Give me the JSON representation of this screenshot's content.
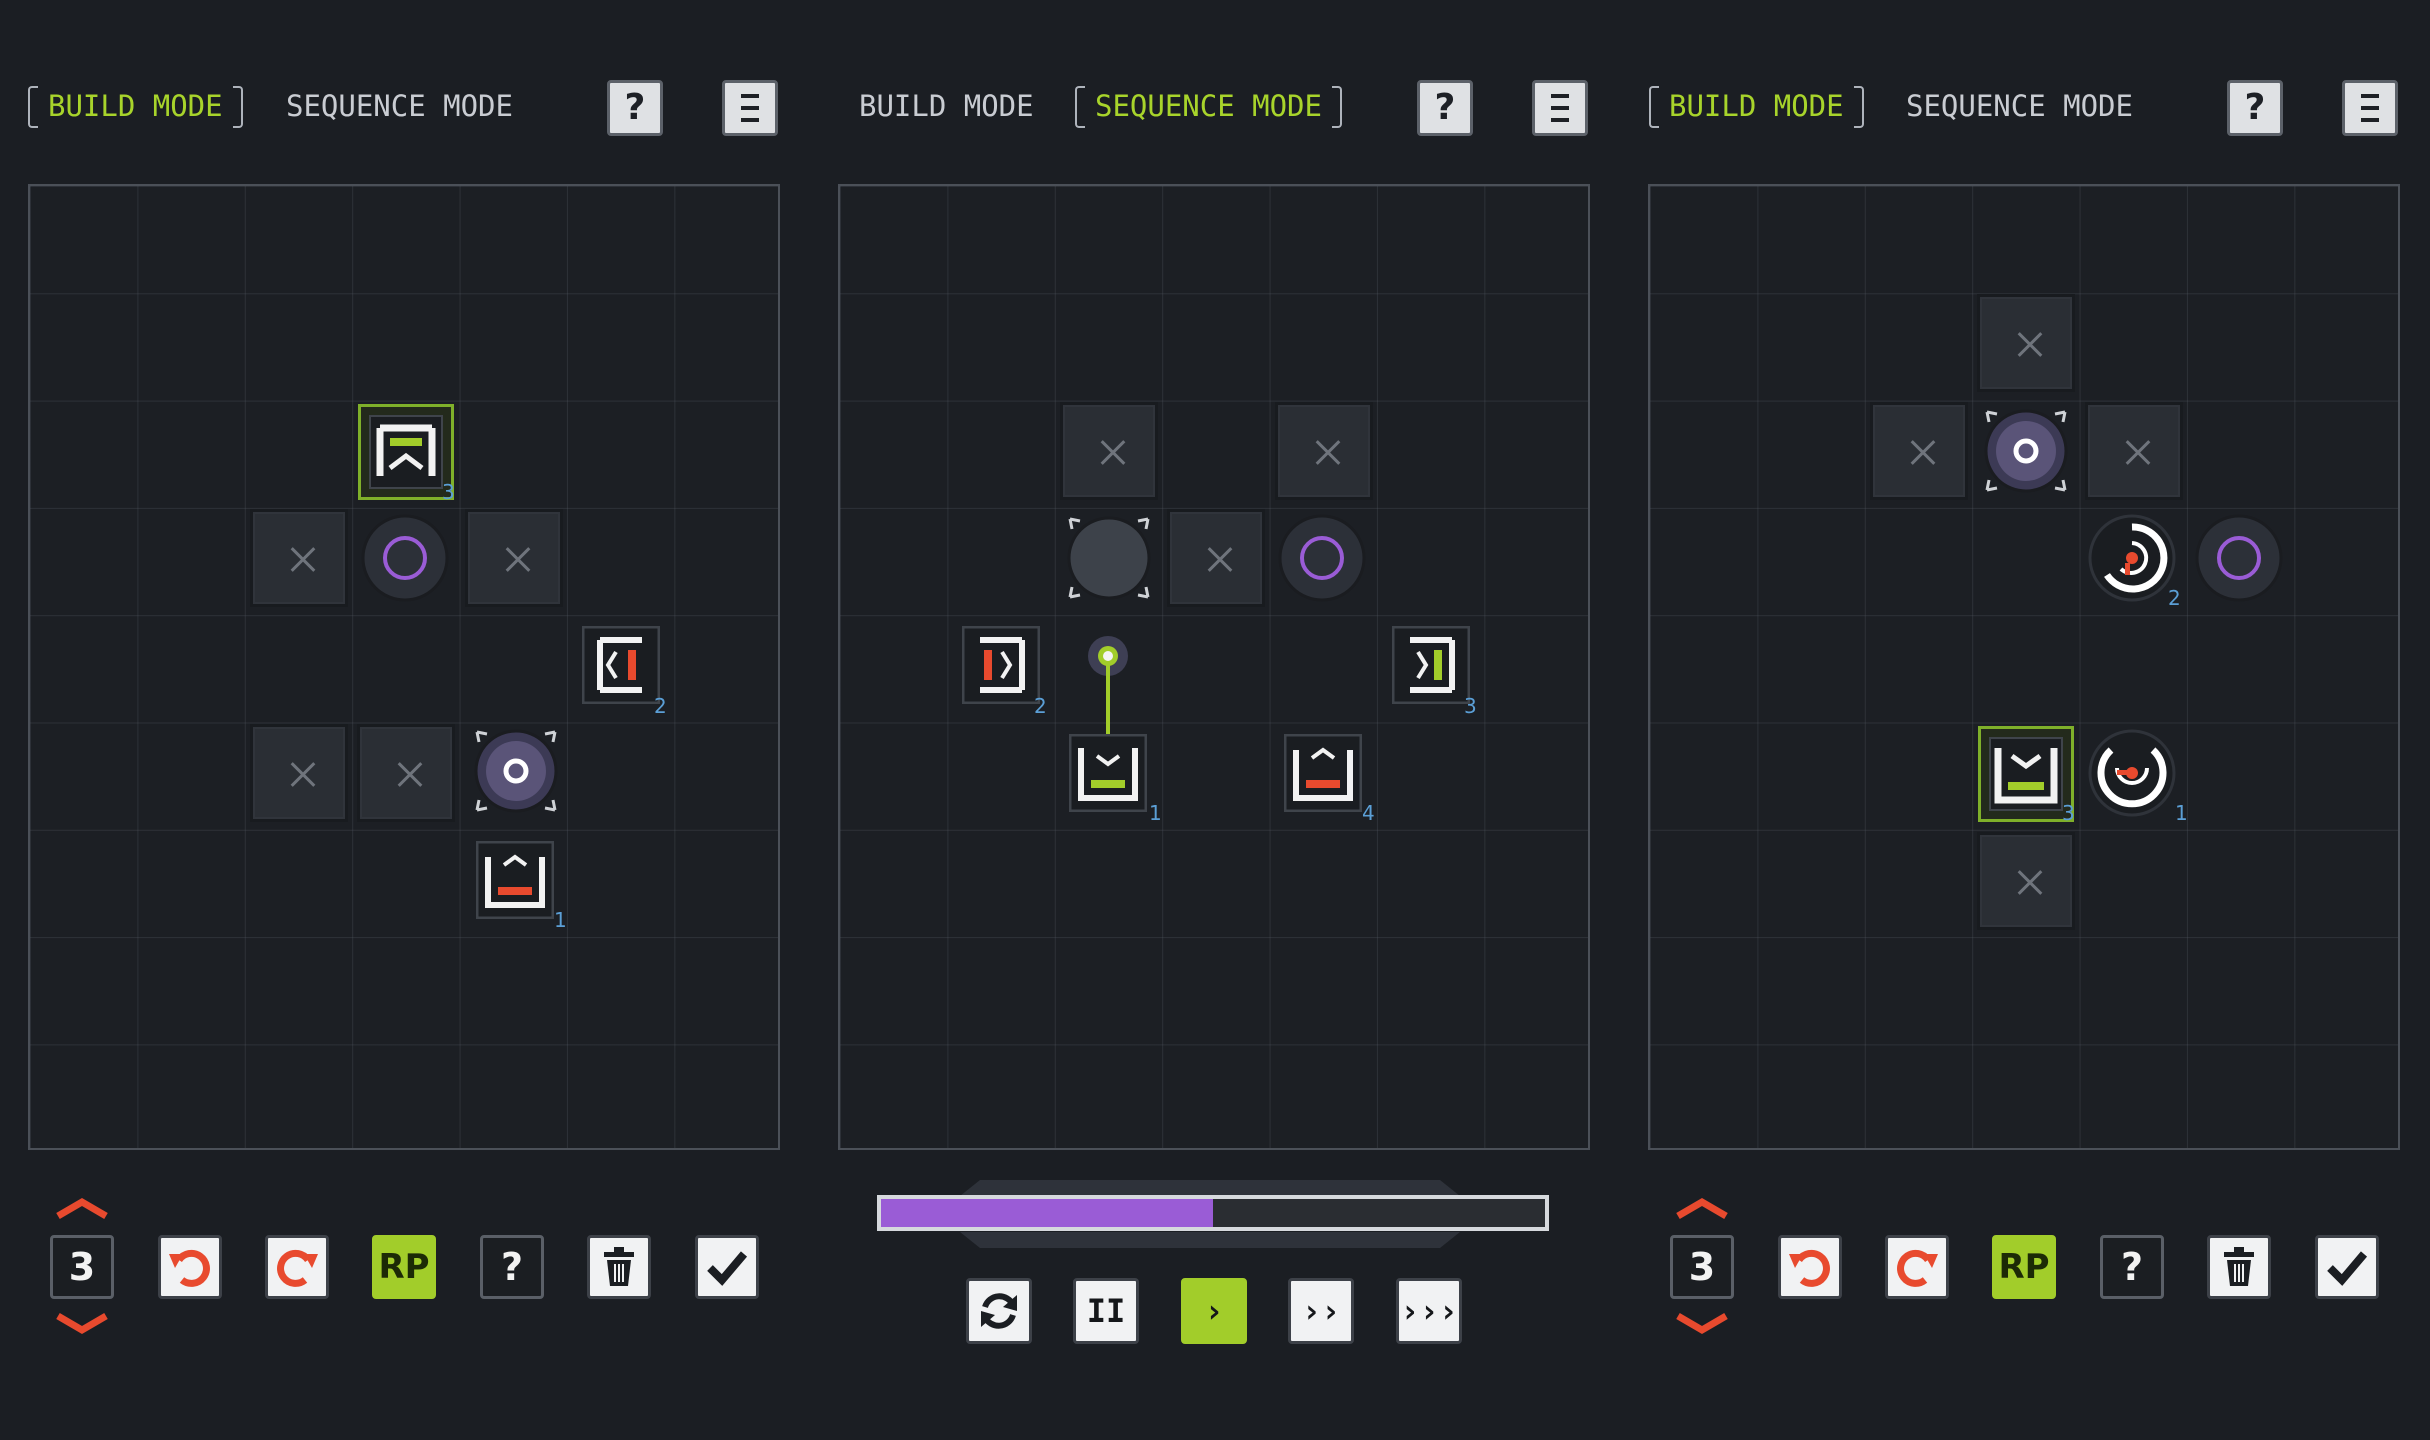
{
  "colors": {
    "accent_green": "#a2cd2a",
    "accent_red": "#e84a2e",
    "accent_purple": "#9a5cd6",
    "number_blue": "#5b9fd6",
    "background": "#1b1e23"
  },
  "panels": [
    {
      "tabs": [
        {
          "label": "BUILD MODE",
          "active": true
        },
        {
          "label": "SEQUENCE MODE",
          "active": false
        }
      ],
      "help_label": "?",
      "menu_icon": "menu-icon",
      "piece_numbers": [
        "3",
        "2",
        "1"
      ],
      "toolbar": {
        "count": "3",
        "rp_label": "RP",
        "help_label": "?"
      }
    },
    {
      "tabs": [
        {
          "label": "BUILD MODE",
          "active": false
        },
        {
          "label": "SEQUENCE MODE",
          "active": true
        }
      ],
      "help_label": "?",
      "menu_icon": "menu-icon",
      "piece_numbers": [
        "2",
        "1",
        "3",
        "4"
      ],
      "progress": 0.5,
      "playback": {
        "pause": "II",
        "step": "›",
        "fast": "››",
        "faster": "›››"
      }
    },
    {
      "tabs": [
        {
          "label": "BUILD MODE",
          "active": true
        },
        {
          "label": "SEQUENCE MODE",
          "active": false
        }
      ],
      "help_label": "?",
      "menu_icon": "menu-icon",
      "piece_numbers": [
        "2",
        "3",
        "1"
      ],
      "toolbar": {
        "count": "3",
        "rp_label": "RP",
        "help_label": "?"
      }
    }
  ]
}
